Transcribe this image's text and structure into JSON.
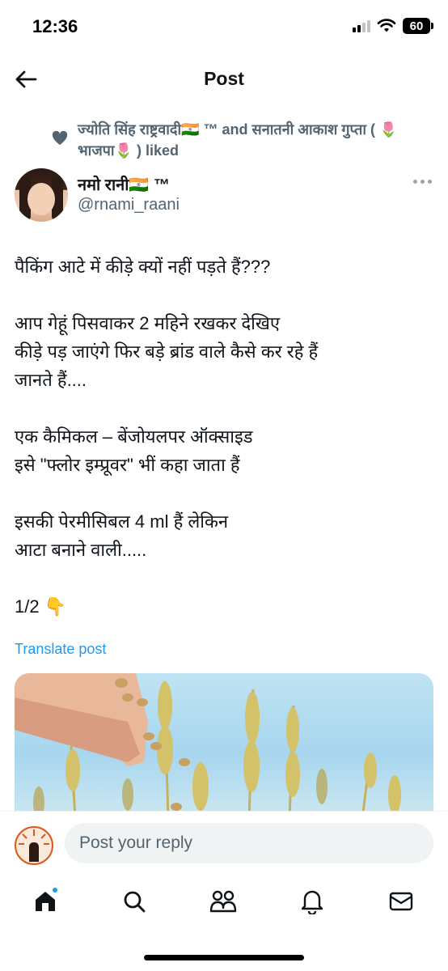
{
  "status_bar": {
    "time": "12:36",
    "battery": "60"
  },
  "header": {
    "title": "Post"
  },
  "social_context": {
    "text": "ज्योति सिंह राष्ट्रवादी🇮🇳 ™ and सनातनी आकाश गुप्ता ( 🌷भाजपा🌷 ) liked"
  },
  "author": {
    "name": "नमो रानी🇮🇳 ™",
    "handle": "@rnami_raani"
  },
  "post": {
    "text": "पैकिंग आटे में कीड़े क्यों नहीं पड़ते हैं???\n\nआप गेहूं पिसवाकर 2 महिने रखकर देखिए\nकीड़े पड़ जाएंगे फिर बड़े ब्रांड वाले कैसे कर रहे हैं\nजानते हैं....\n\nएक कैमिकल – बेंजोयलपर ऑक्साइड\nइसे \"फ्लोर इम्प्रूवर\" भीं कहा जाता हैं\n\nइसकी पेरमीसिबल 4 ml हैं लेकिन\nआटा बनाने वाली.....\n\n1/2 👇",
    "translate_label": "Translate post"
  },
  "reply": {
    "placeholder": "Post your reply"
  },
  "colors": {
    "accent": "#1d9bf0",
    "text_secondary": "#536471",
    "reply_bg": "#eff3f4"
  },
  "icons": [
    "back-arrow-icon",
    "heart-icon",
    "more-icon",
    "home-icon",
    "search-icon",
    "communities-icon",
    "bell-icon",
    "mail-icon"
  ]
}
